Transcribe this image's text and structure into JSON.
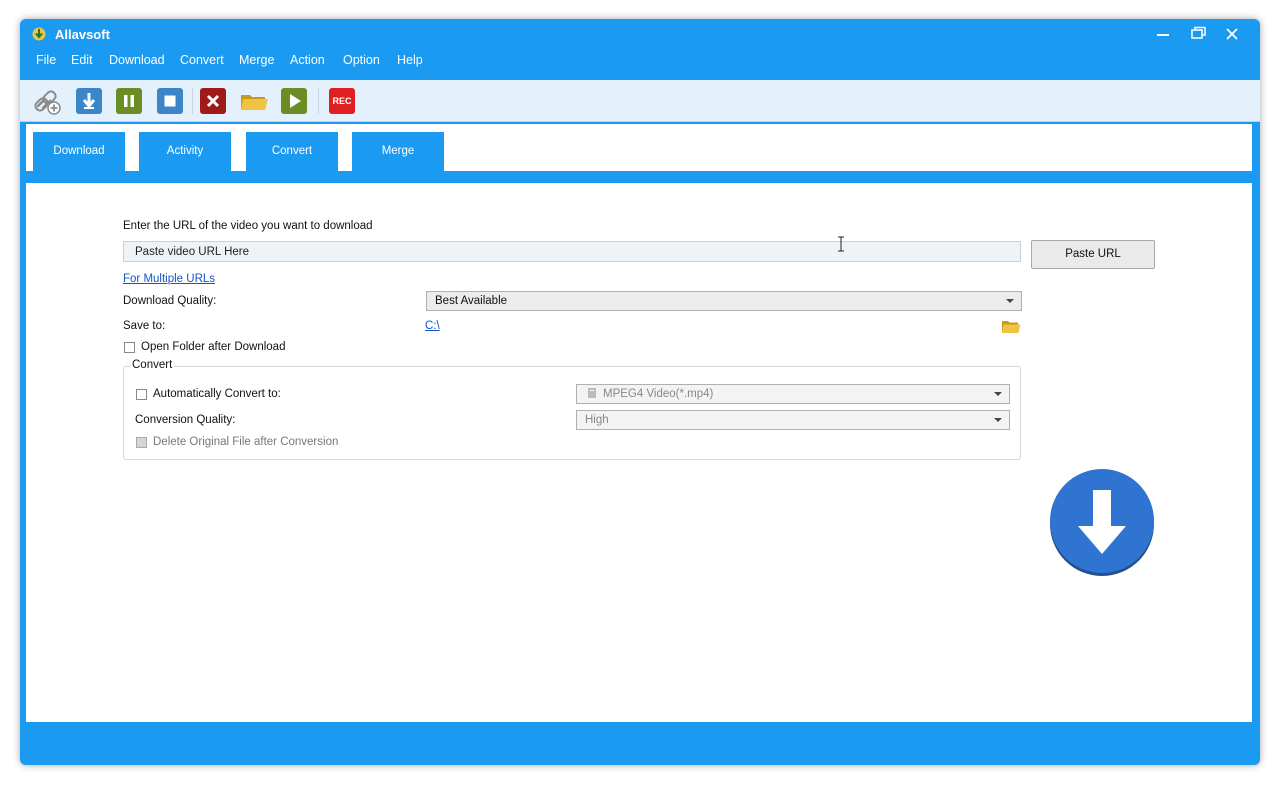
{
  "window": {
    "title": "Allavsoft",
    "controls": [
      "minimize-icon",
      "restore-icon",
      "close-icon"
    ]
  },
  "menu": [
    "File",
    "Edit",
    "Download",
    "Convert",
    "Merge",
    "Action",
    "Option",
    "Help"
  ],
  "toolbar": {
    "buttons": [
      {
        "name": "add-url-icon",
        "color": "#8a8a8a"
      },
      {
        "name": "download-icon",
        "color": "#3a86c8"
      },
      {
        "name": "pause-icon",
        "color": "#6a8e23"
      },
      {
        "name": "stop-icon",
        "color": "#3a86c8"
      },
      {
        "name": "delete-icon",
        "color": "#a01a1a"
      },
      {
        "name": "folder-icon",
        "color": "#e0b53a"
      },
      {
        "name": "play-icon",
        "color": "#6a8e23"
      },
      {
        "name": "record-icon",
        "color": "#e02020"
      }
    ],
    "rec_label": "REC"
  },
  "tabs": [
    "Download",
    "Activity",
    "Convert",
    "Merge"
  ],
  "download_panel": {
    "url_prompt": "Enter the URL of the video you want to download",
    "url_placeholder": "Paste video URL Here",
    "paste_button": "Paste URL",
    "multiple_urls_link": "For Multiple URLs",
    "quality_label": "Download Quality:",
    "quality_value": "Best Available",
    "save_to_label": "Save to:",
    "save_to_path": "C:\\",
    "open_folder_label": "Open Folder after Download",
    "open_folder_checked": false
  },
  "convert_group": {
    "title": "Convert",
    "auto_convert_label": "Automatically Convert to:",
    "auto_convert_checked": false,
    "format_value": "MPEG4 Video(*.mp4)",
    "conversion_quality_label": "Conversion Quality:",
    "conversion_quality_value": "High",
    "delete_original_label": "Delete Original File after Conversion",
    "delete_original_checked": false
  },
  "colors": {
    "accent": "#1a9af0",
    "toolbar_bg": "#e4f1fc",
    "big_button": "#2f74d0"
  }
}
